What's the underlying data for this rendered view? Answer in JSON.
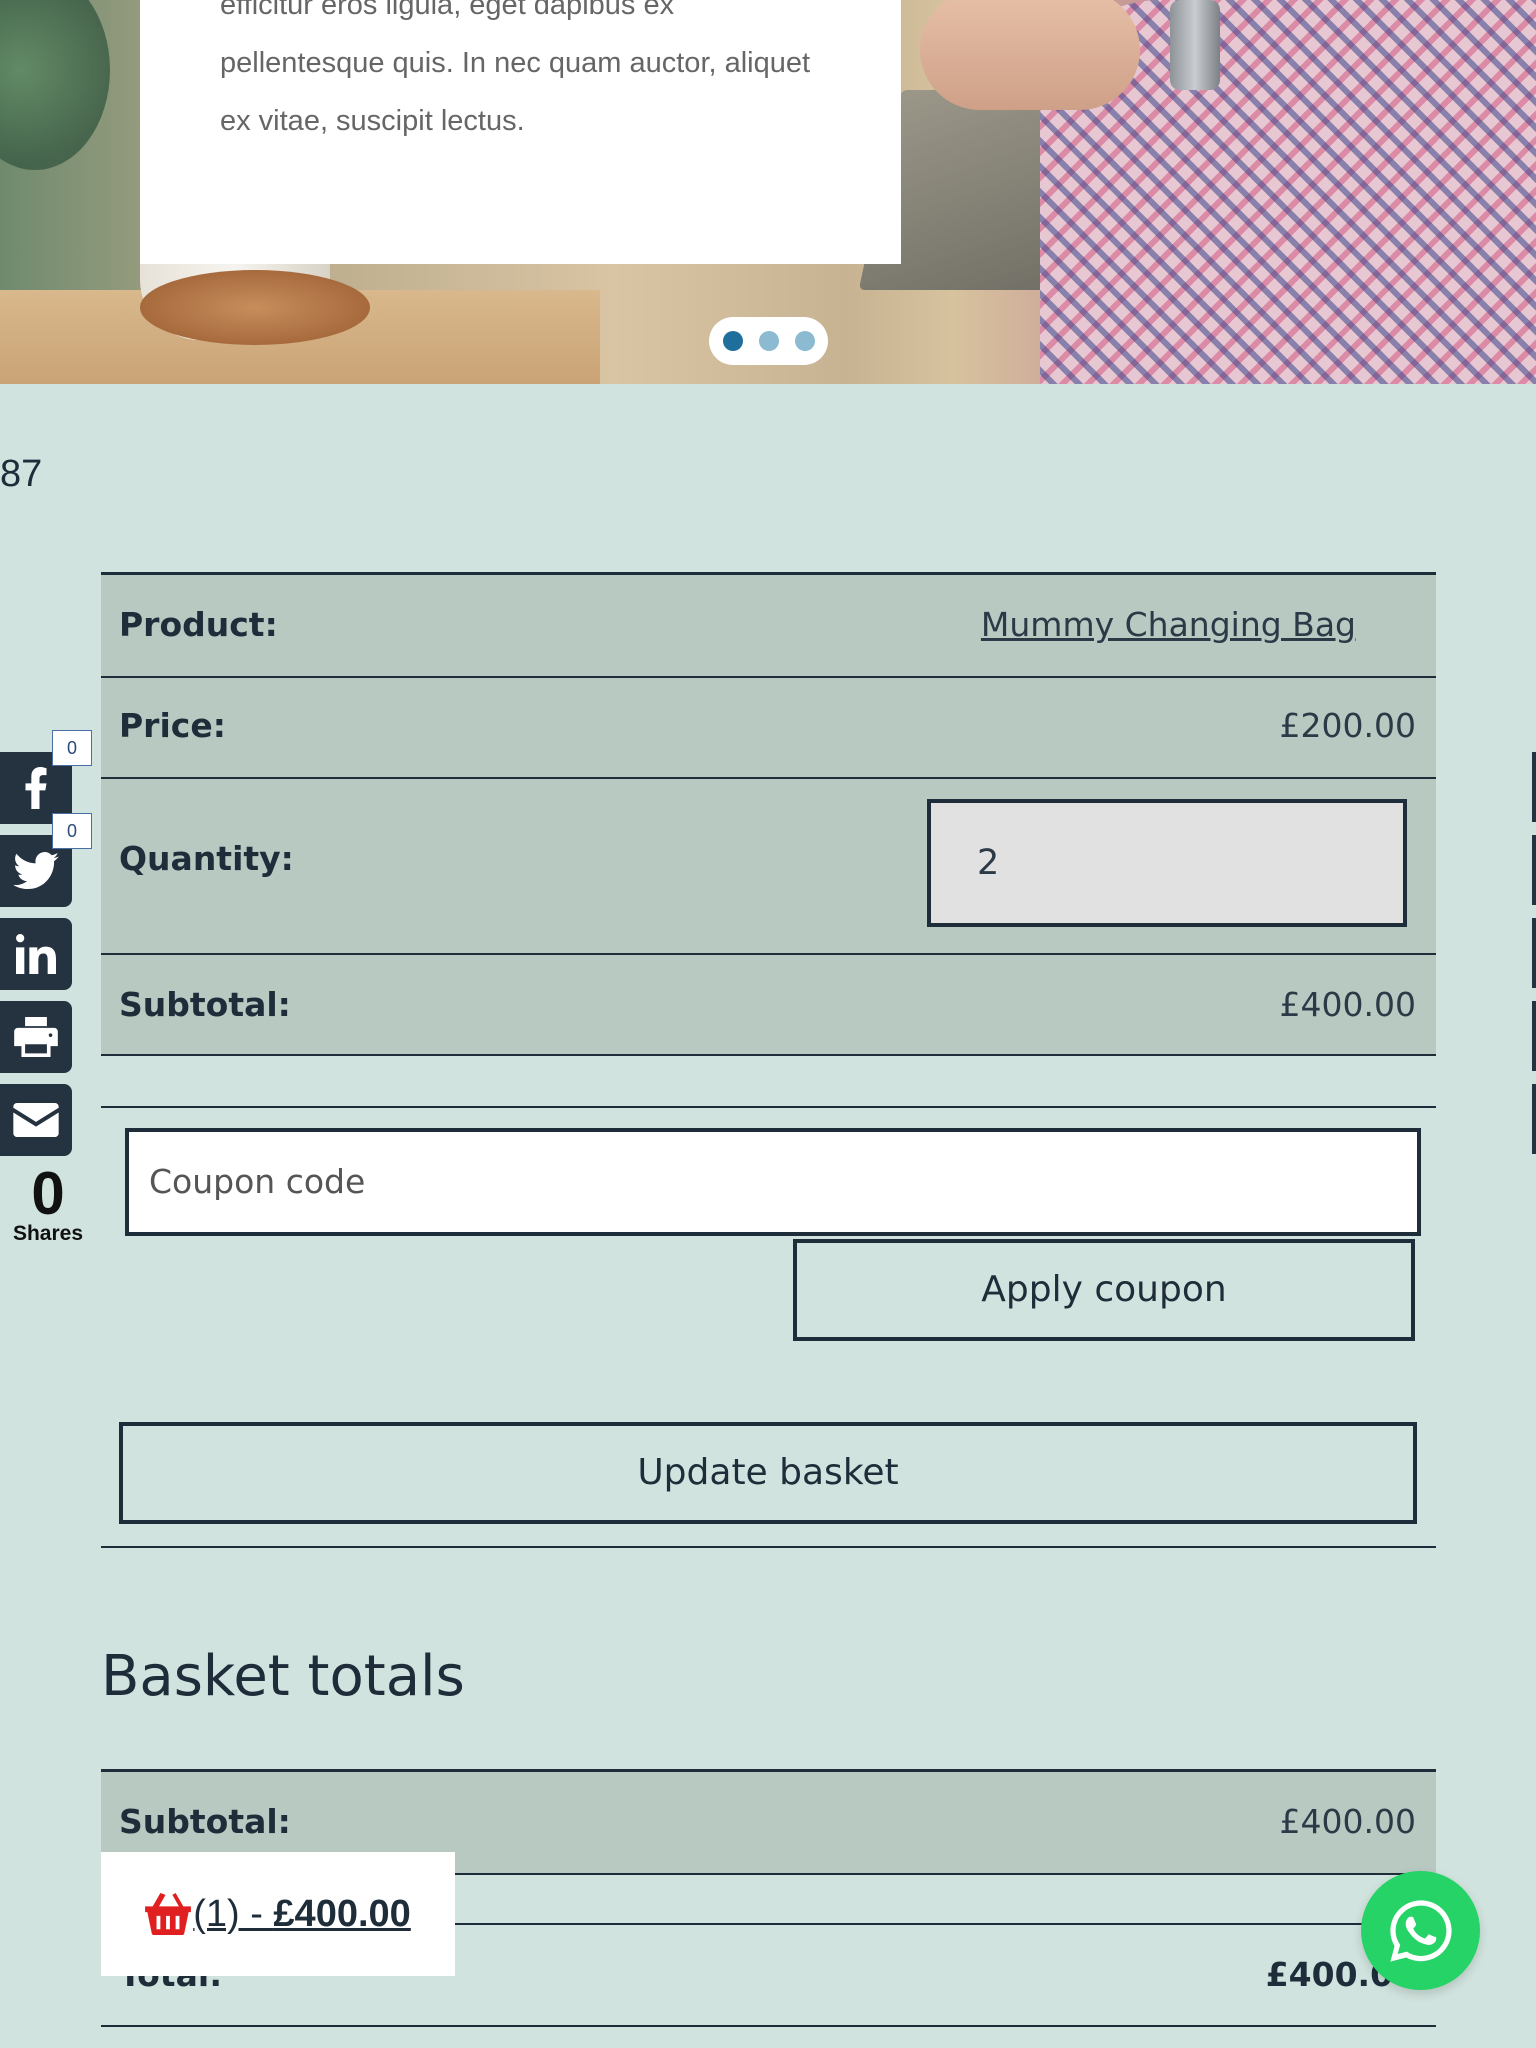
{
  "hero": {
    "card_text": "efficitur eros ligula, eget dapibus ex pellentesque quis. In nec quam auctor, aliquet ex vitae, suscipit lectus.",
    "slides": 3,
    "active_slide": 1
  },
  "counter": "87",
  "social": {
    "facebook_count": "0",
    "twitter_count": "0",
    "shares_count": "0",
    "shares_label": "Shares"
  },
  "cart": {
    "product_label": "Product:",
    "product_name": "Mummy Changing Bag",
    "price_label": "Price:",
    "price": "£200.00",
    "quantity_label": "Quantity:",
    "quantity": "2",
    "subtotal_label": "Subtotal:",
    "subtotal": "£400.00",
    "coupon_placeholder": "Coupon code",
    "apply_coupon": "Apply coupon",
    "update_basket": "Update basket"
  },
  "totals": {
    "title": "Basket totals",
    "subtotal_label": "Subtotal:",
    "subtotal": "£400.00",
    "total_label": "Total:",
    "total": "£400.00"
  },
  "mini_cart": {
    "count": "(1) - ",
    "amount": "£400.00"
  },
  "colors": {
    "background": "#d1e3de",
    "row": "#b8c9c2",
    "dark": "#1f2d3a",
    "whatsapp": "#25d366",
    "basket_icon": "#e02020"
  }
}
